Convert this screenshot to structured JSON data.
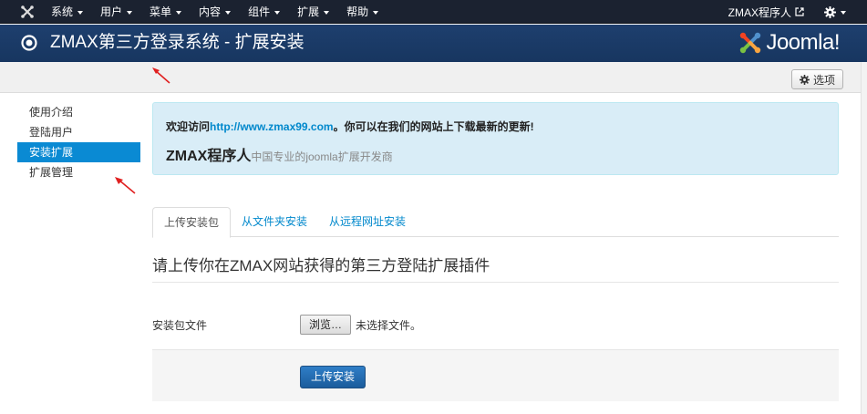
{
  "menubar": {
    "items": [
      {
        "label": "系统"
      },
      {
        "label": "用户"
      },
      {
        "label": "菜单"
      },
      {
        "label": "内容"
      },
      {
        "label": "组件"
      },
      {
        "label": "扩展"
      },
      {
        "label": "帮助"
      }
    ],
    "site_user": "ZMAX程序人"
  },
  "header": {
    "title": "ZMAX第三方登录系统 - 扩展安装",
    "brand": "Joomla!"
  },
  "toolbar": {
    "options_label": "选项"
  },
  "sidebar": {
    "items": [
      {
        "label": "使用介绍"
      },
      {
        "label": "登陆用户"
      },
      {
        "label": "安装扩展"
      },
      {
        "label": "扩展管理"
      }
    ]
  },
  "alert": {
    "prefix": "欢迎访问",
    "link": "http://www.zmax99.com",
    "suffix": "。你可以在我们的网站上下载最新的更新!",
    "name": "ZMAX程序人",
    "desc": "中国专业的joomla扩展开发商"
  },
  "tabs": [
    {
      "label": "上传安装包"
    },
    {
      "label": "从文件夹安装"
    },
    {
      "label": "从远程网址安装"
    }
  ],
  "form": {
    "legend": "请上传你在ZMAX网站获得的第三方登陆扩展插件",
    "file_label": "安装包文件",
    "browse_label": "浏览…",
    "no_file": "未选择文件。",
    "submit_label": "上传安装"
  },
  "colors": {
    "menubar_bg": "#1b2230",
    "header_bg": "#1e3f6e",
    "active_sidebar": "#0a8ad3",
    "link": "#0088cc",
    "alert_bg": "#d9edf7",
    "primary_button": "#2f7ec7",
    "annotation_arrow": "#e02020"
  }
}
